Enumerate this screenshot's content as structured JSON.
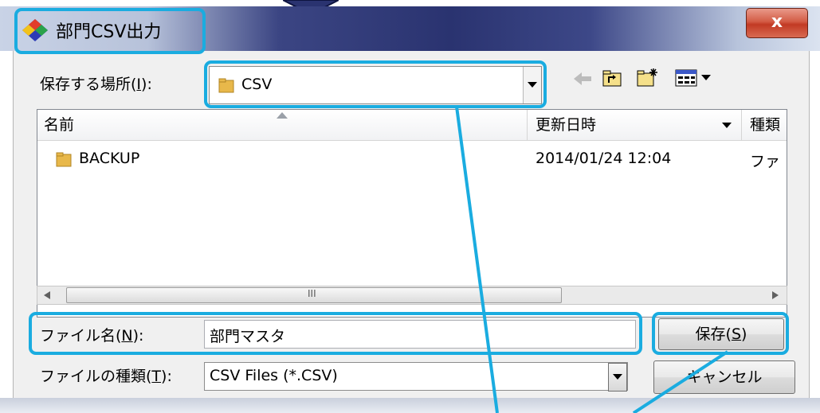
{
  "window": {
    "title": "部門CSV出力",
    "close_label": "x"
  },
  "save_in": {
    "label_prefix": "保存する場所(",
    "label_key": "I",
    "label_suffix": "):",
    "value": "CSV"
  },
  "list": {
    "columns": [
      "名前",
      "更新日時",
      "種類"
    ],
    "items": [
      {
        "name": "BACKUP",
        "modified": "2014/01/24 12:04",
        "type": "ファ"
      }
    ],
    "scroll_thumb_glyph": "III"
  },
  "filename": {
    "label_prefix": "ファイル名(",
    "label_key": "N",
    "label_suffix": "):",
    "value": "部門マスタ"
  },
  "filetype": {
    "label_prefix": "ファイルの種類(",
    "label_key": "T",
    "label_suffix": "):",
    "value": "CSV Files (*.CSV)"
  },
  "buttons": {
    "save_prefix": "保存(",
    "save_key": "S",
    "save_suffix": ")",
    "cancel": "キャンセル"
  },
  "colors": {
    "highlight": "#1aace0",
    "title_dark": "#2a3370",
    "folder": "#e8b84a"
  }
}
